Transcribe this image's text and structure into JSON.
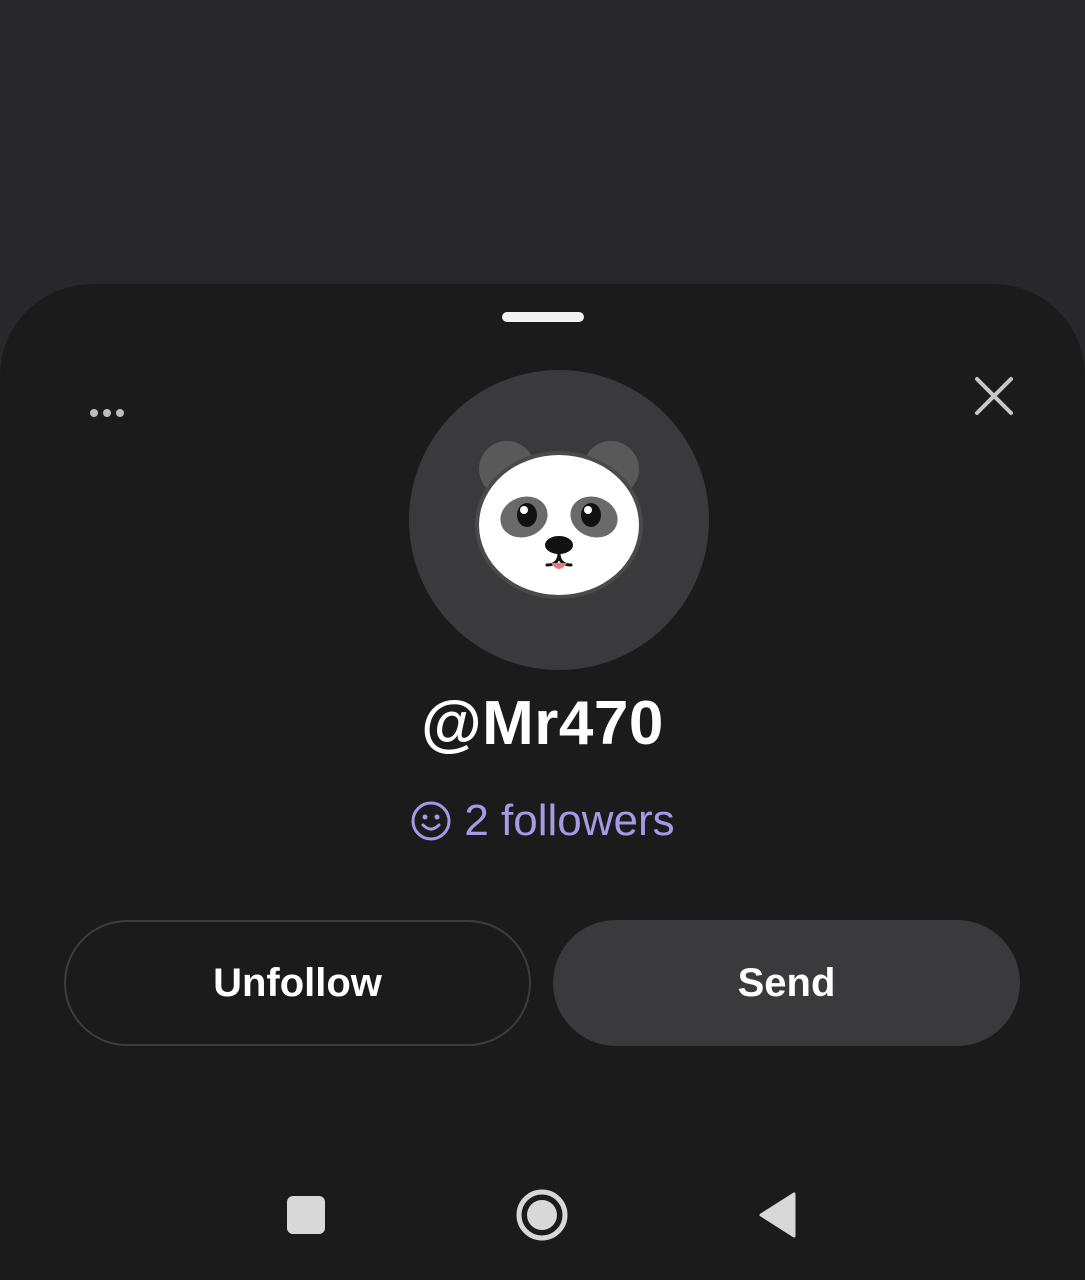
{
  "profile": {
    "username": "@Mr470",
    "followers_text": "2 followers",
    "avatar_icon": "panda-face-icon"
  },
  "actions": {
    "unfollow_label": "Unfollow",
    "send_label": "Send"
  },
  "header": {
    "more_icon": "more-horizontal-icon",
    "close_icon": "close-icon"
  },
  "navigation": {
    "recents_icon": "square-icon",
    "home_icon": "circle-home-icon",
    "back_icon": "triangle-back-icon"
  },
  "colors": {
    "sheet_background": "#1b1b1c",
    "accent_followers": "#a69ae6",
    "button_fill": "#3a3a3c"
  }
}
